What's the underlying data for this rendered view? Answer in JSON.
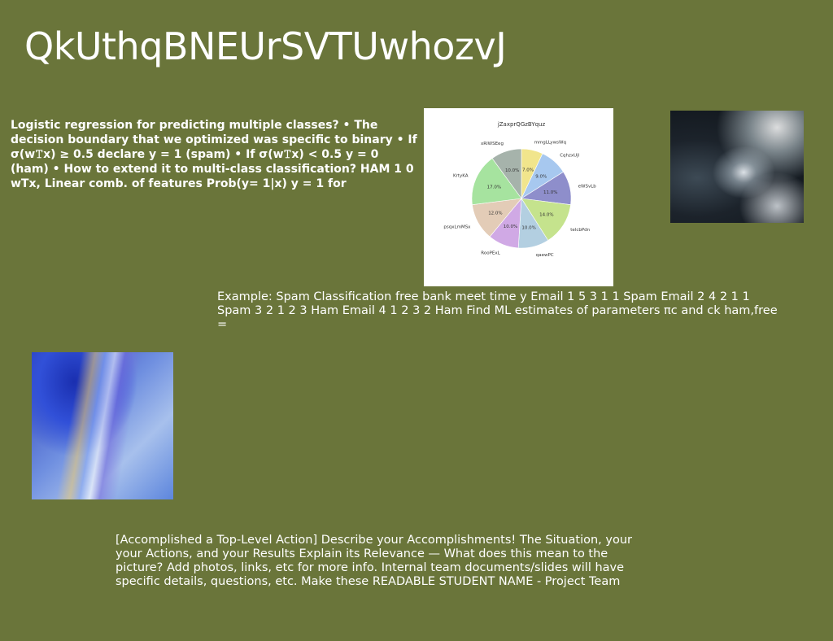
{
  "slide": {
    "title": "QkUthqBNEUrSVTUwhozvJ",
    "bold_paragraph": "Logistic regression for predicting multiple classes? • The decision boundary that we optimized was specific to binary • If σ(w𝚃x) ≥ 0.5 declare y = 1 (spam) • If σ(w𝚃x) < 0.5 y = 0 (ham) • How to extend it to multi-class classification? HAM 1 0 wTx, Linear comb. of features Prob(y= 1|x) y = 1 for",
    "example_paragraph": "Example: Spam Classification free bank meet time y Email 1 5 3 1 1 Spam Email 2 4 2 1 1 Spam 3 2 1 2 3 Ham Email 4 1 2 3 2 Ham Find ML estimates of parameters πc and ck ham,free =",
    "accomplish_paragraph": "[Accomplished a Top-Level Action]  Describe your Accomplishments! The Situation, your your Actions, and your Results  Explain its Relevance — What does this mean to the picture?  Add photos, links, etc for more info. Internal team documents/slides will have specific details, questions, etc.  Make these READABLE STUDENT NAME - Project Team"
  },
  "chart_data": {
    "type": "pie",
    "title": "jZaxprQGzBYquz",
    "categories": [
      "mmgLLywsWq",
      "CqhzxUjl",
      "eWSvLb",
      "telcbPdn",
      "qaewPC",
      "RooPExL",
      "psqxLmMSx",
      "KrtyKA",
      "xRlWSEeg"
    ],
    "values": [
      7.0,
      9.0,
      11.0,
      14.0,
      10.0,
      10.0,
      12.0,
      17.0,
      10.0
    ],
    "value_labels": [
      "7.0%",
      "9.0%",
      "11.0%",
      "14.0%",
      "10.0%",
      "10.0%",
      "12.0%",
      "17.0%",
      "10.0%"
    ],
    "colors": [
      "#f1e58c",
      "#a7c8ef",
      "#8e8ecb",
      "#c5e38d",
      "#b3cfe1",
      "#d0a9e5",
      "#e3ccb7",
      "#a6e39f",
      "#a6b3ab"
    ]
  }
}
